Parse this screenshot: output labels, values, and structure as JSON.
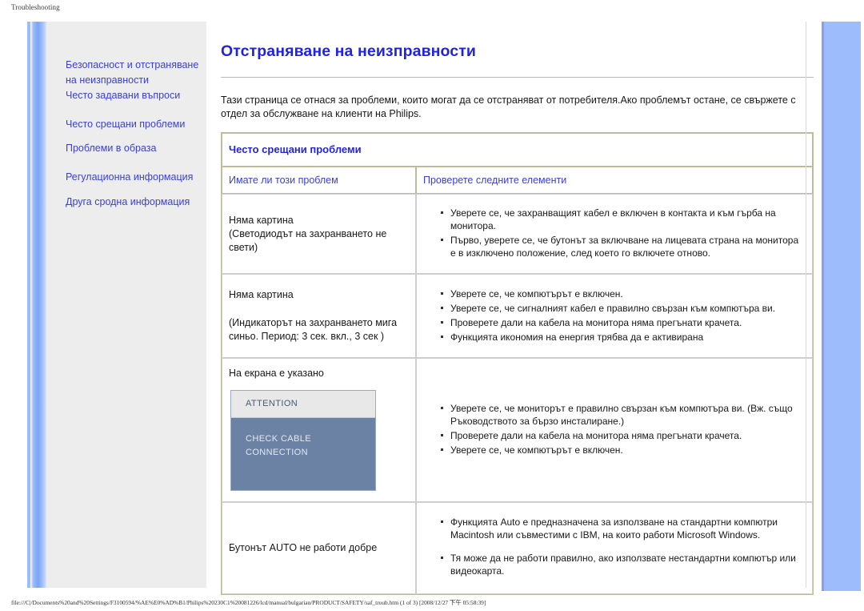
{
  "print_header": "Troubleshooting",
  "sidebar": {
    "groups": [
      {
        "items": [
          {
            "label": "Безопасност и отстраняване"
          },
          {
            "label": "на неизправности"
          },
          {
            "label": "Често задавани въпроси"
          }
        ]
      },
      {
        "items": [
          {
            "label": "Често срещани проблеми"
          },
          {
            "label": "Проблеми в образа"
          }
        ]
      },
      {
        "items": [
          {
            "label": "Регулационна информация"
          },
          {
            "label": "Друга сродна информация"
          }
        ]
      }
    ]
  },
  "main": {
    "title": "Отстраняване на неизправности",
    "intro": "Тази страница се отнася за проблеми, които могат да се отстраняват от потребителя.Ако проблемът остане, се свържете с отдел за обслужване на клиенти на Philips.",
    "table": {
      "caption": "Често срещани проблеми",
      "col_head_left": "Имате ли този проблем",
      "col_head_right": "Проверете следните елементи",
      "rows": [
        {
          "question_line1": "Няма картина",
          "question_line2": "(Светодиодът на захранването не",
          "question_line3": "свети)",
          "answers": [
            "Уверете се, че захранващият кабел е включен в контакта и към гърба на монитора.",
            "Първо, уверете се, че бутонът за включване на лицевата страна на монитора е в изключено положение, след което го включете отново."
          ]
        },
        {
          "question_line1": "Няма картина",
          "question_line2": "(Индикаторът на захранването мига",
          "question_line3": "синьо. Период: 3 сек. вкл., 3 сек )",
          "answers": [
            "Уверете се, че компютърът е включен.",
            "Уверете се, че сигналният кабел е правилно свързан към компютъра ви.",
            "Проверете дали на кабела на монитора няма прегънати крачета.",
            "Функцията икономия на енергия трябва да е активирана"
          ]
        },
        {
          "question_line1": "На екрана е указано",
          "attention_title": "ATTENTION",
          "attention_body": "CHECK CABLE CONNECTION",
          "answers": [
            "Уверете се, че мониторът е правилно свързан към компютъра ви. (Вж. също Ръководството за бързо инсталиране.)",
            "Проверете дали на кабела на монитора няма прегънати крачета.",
            "Уверете се, че компютърът е включен."
          ]
        },
        {
          "question_line1": "Бутонът AUTO не работи добре",
          "answers": [
            "Функцията Auto е предназначена за използване на стандартни компютри Macintosh или съвместими с IBM, на които работи Microsoft Windows.",
            "Тя може да не работи правилно, ако използвате нестандартни компютър или видеокарта."
          ]
        }
      ]
    }
  },
  "statusbar": {
    "text": "file:///C|/Documents%20and%20Settings/F3100594/%AE%E0%AD%B1/Philips%20230C1%20081226/lcd/manual/bulgarian/PRODUCT/SAFETY/saf_troub.htm (1 of 3) [2008/12/27 下午 05:58:39]"
  },
  "colors": {
    "accent_blue": "#9cbcfb",
    "link_blue": "#3a40d8",
    "title_blue": "#2222e2",
    "sidebar_bg": "#ededed",
    "attention_bg": "#6b82a5"
  }
}
